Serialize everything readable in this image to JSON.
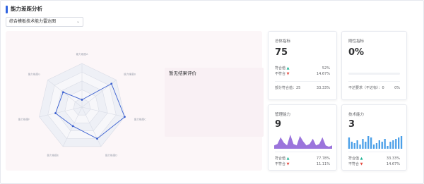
{
  "section_title": "能力差距分析",
  "selector": {
    "value": "综合模板技术能力雷达图"
  },
  "radar": {
    "axes": [
      "能力维度A",
      "能力维度B",
      "能力维度C",
      "能力维度D",
      "能力维度E",
      "能力维度F",
      "能力维度G"
    ],
    "values": [
      0.17,
      0.86,
      1.0,
      0.8,
      0.48,
      0.62,
      0.55
    ],
    "line_color": "#3a5fd0"
  },
  "evaluation": {
    "text": "暂无结果评价"
  },
  "cards": {
    "total": {
      "title": "总体指标",
      "value": "75",
      "rows": [
        {
          "label": "符合值",
          "value": "52%"
        },
        {
          "label": "不符合",
          "value": "14.67%"
        },
        {
          "label": "部分符合值：25",
          "value": "33.33%"
        }
      ]
    },
    "rigid": {
      "title": "刚性指标",
      "value": "0%",
      "progress": 0,
      "rows": [
        {
          "label": "不达要求（不达标）：0",
          "value": "0%"
        }
      ]
    },
    "management": {
      "title": "管理能力",
      "value": "9",
      "rows": [
        {
          "label": "符合值",
          "value": "77.78%"
        },
        {
          "label": "不符合",
          "value": "11.11%"
        }
      ],
      "sparkline": [
        2,
        3,
        8,
        4,
        2,
        10,
        3,
        2,
        9,
        5,
        2,
        3,
        7,
        2,
        3,
        8,
        2,
        1,
        2
      ],
      "color": "#8a5cd6"
    },
    "technical": {
      "title": "技术能力",
      "value": "3",
      "rows": [
        {
          "label": "符合值",
          "value": "33.33%"
        },
        {
          "label": "不符合",
          "value": "14.67%"
        }
      ],
      "bars": [
        8,
        5,
        4,
        6,
        3,
        7,
        5,
        9,
        8,
        3,
        4,
        6,
        5,
        7,
        2,
        5,
        6,
        7,
        8,
        9
      ],
      "color": "#4a9fe8"
    }
  }
}
